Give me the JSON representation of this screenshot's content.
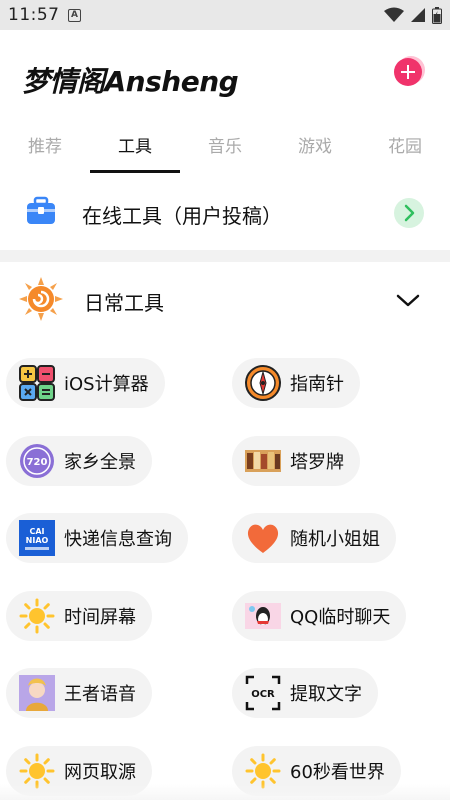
{
  "status_bar": {
    "time": "11:57",
    "notification_letter": "A"
  },
  "header": {
    "title": "梦情阁Ansheng"
  },
  "tabs": [
    {
      "label": "推荐",
      "active": false
    },
    {
      "label": "工具",
      "active": true
    },
    {
      "label": "音乐",
      "active": false
    },
    {
      "label": "游戏",
      "active": false
    },
    {
      "label": "花园",
      "active": false
    }
  ],
  "online_tools": {
    "label": "在线工具（用户投稿）",
    "icon": "toolbox-icon"
  },
  "section": {
    "label": "日常工具",
    "icon": "sun-swirl-icon",
    "expanded": true
  },
  "tools": [
    {
      "label": "iOS计算器",
      "icon": "calculator-icon"
    },
    {
      "label": "指南针",
      "icon": "compass-icon"
    },
    {
      "label": "家乡全景",
      "icon": "panorama-720-icon"
    },
    {
      "label": "塔罗牌",
      "icon": "tarot-icon"
    },
    {
      "label": "快递信息查询",
      "icon": "cainiao-icon",
      "icon_text": "CAI NIAO"
    },
    {
      "label": "随机小姐姐",
      "icon": "heart-icon"
    },
    {
      "label": "时间屏幕",
      "icon": "sun-icon"
    },
    {
      "label": "QQ临时聊天",
      "icon": "qq-icon"
    },
    {
      "label": "王者语音",
      "icon": "game-avatar-icon"
    },
    {
      "label": "提取文字",
      "icon": "ocr-icon",
      "icon_text": "OCR"
    },
    {
      "label": "网页取源",
      "icon": "sun-icon"
    },
    {
      "label": "60秒看世界",
      "icon": "sun-icon"
    }
  ],
  "colors": {
    "accent_pink": "#f0336b",
    "arrow_green": "#2fbf5e",
    "chip_bg": "#f3f3f3",
    "sun_yellow": "#ffc42e",
    "orange": "#f58a2b"
  }
}
